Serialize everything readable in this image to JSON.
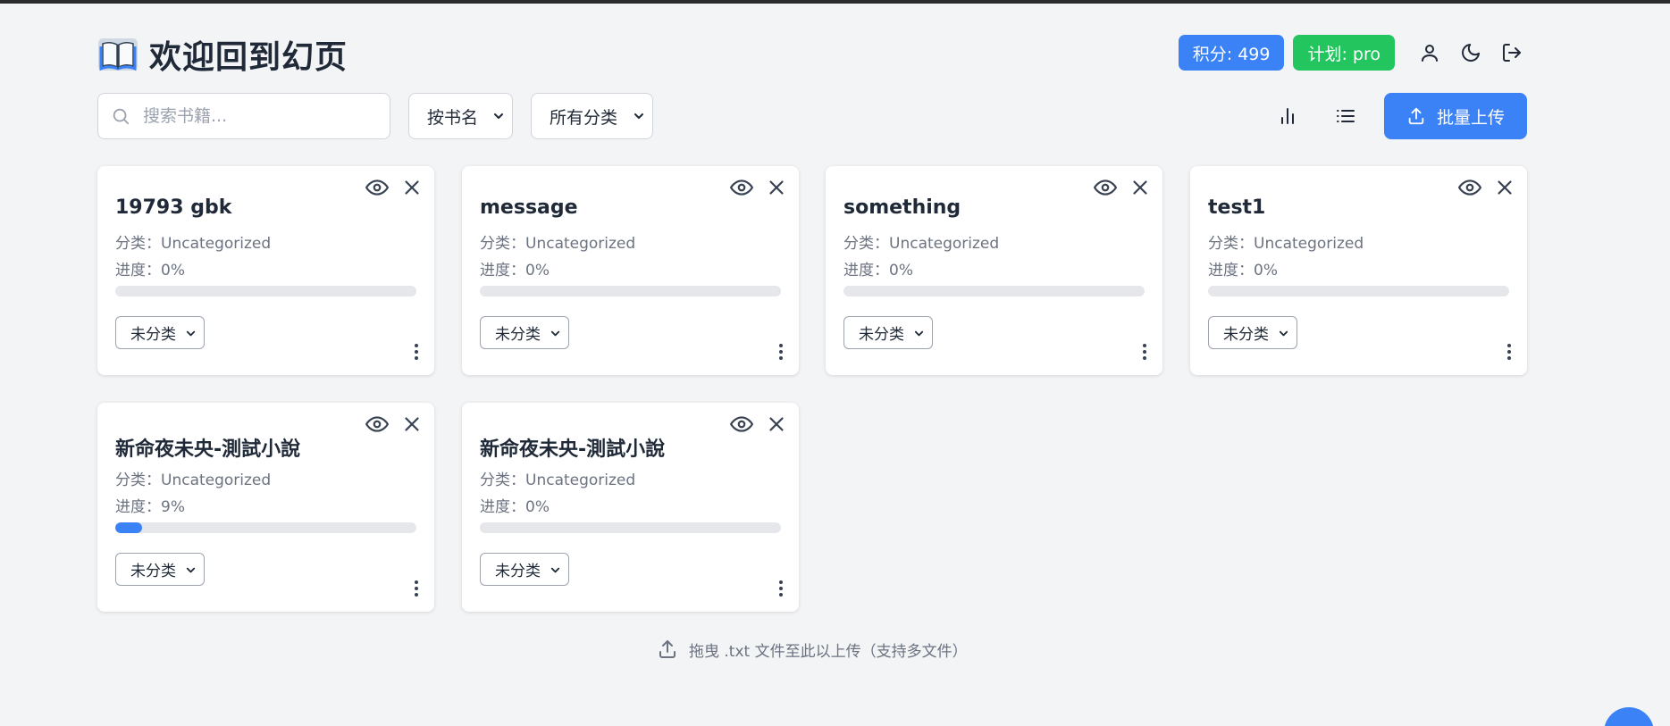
{
  "header": {
    "title": "欢迎回到幻页",
    "points_badge": "积分: 499",
    "plan_badge": "计划: pro"
  },
  "toolbar": {
    "search_placeholder": "搜索书籍...",
    "sort_select": "按书名",
    "category_select": "所有分类",
    "upload_label": "批量上传"
  },
  "books": [
    {
      "title": "19793 gbk",
      "category": "分类：Uncategorized",
      "progress_text": "进度：0%",
      "progress": 0,
      "select": "未分类"
    },
    {
      "title": "message",
      "category": "分类：Uncategorized",
      "progress_text": "进度：0%",
      "progress": 0,
      "select": "未分类"
    },
    {
      "title": "something",
      "category": "分类：Uncategorized",
      "progress_text": "进度：0%",
      "progress": 0,
      "select": "未分类"
    },
    {
      "title": "test1",
      "category": "分类：Uncategorized",
      "progress_text": "进度：0%",
      "progress": 0,
      "select": "未分类"
    },
    {
      "title": "新命夜未央-測試小說",
      "category": "分类：Uncategorized",
      "progress_text": "进度：9%",
      "progress": 9,
      "select": "未分类"
    },
    {
      "title": "新命夜未央-測試小說",
      "category": "分类：Uncategorized",
      "progress_text": "进度：0%",
      "progress": 0,
      "select": "未分类"
    }
  ],
  "dropzone": {
    "text": "拖曳 .txt 文件至此以上传（支持多文件）"
  },
  "colors": {
    "accent": "#3b82f6",
    "plan_green": "#22c55e",
    "background": "#f3f4f6"
  },
  "icons": {
    "logo": "open-book-icon",
    "user": "user-icon",
    "theme": "moon-icon",
    "logout": "logout-icon",
    "stats": "bar-chart-icon",
    "list": "list-icon",
    "upload": "upload-icon",
    "preview": "eye-icon",
    "delete": "close-icon",
    "more": "more-vertical-icon"
  }
}
